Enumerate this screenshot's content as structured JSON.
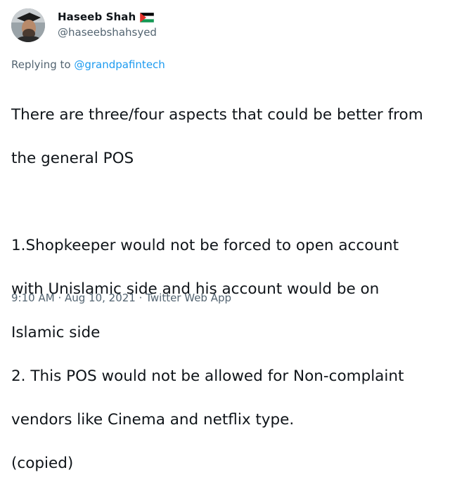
{
  "author": {
    "display_name": "Haseeb Shah",
    "handle": "@haseebshahsyed",
    "flag_icon": "palestine-flag-icon"
  },
  "reply": {
    "prefix": "Replying to",
    "mention": "@grandpafintech"
  },
  "tweet": {
    "lines": [
      "There are three/four aspects that could be better from",
      "the general POS",
      "",
      "1.Shopkeeper would not be forced to open account",
      "with Unislamic side and his account would be on",
      "Islamic side",
      "2. This POS would not be allowed for Non-complaint",
      "vendors like Cinema and netflix type.",
      "(copied)"
    ]
  },
  "meta": {
    "time": "9:10 AM",
    "date": "Aug 10, 2021",
    "source": "Twitter Web App",
    "separator": "·"
  },
  "colors": {
    "text": "#0f1419",
    "secondary": "#536471",
    "link": "#1d9bf0"
  }
}
